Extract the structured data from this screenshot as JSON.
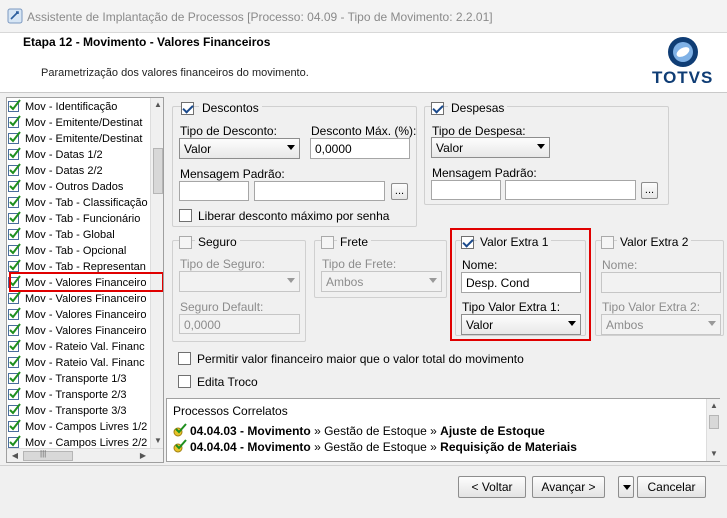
{
  "window": {
    "title": "Assistente de Implantação de Processos [Processo: 04.09 - Tipo de Movimento: 2.2.01]"
  },
  "header": {
    "step_title": "Etapa 12 - Movimento - Valores Financeiros",
    "step_description": "Parametrização dos valores financeiros do movimento.",
    "logo_text": "TOTVS"
  },
  "nav": {
    "items": [
      "Mov - Identificação",
      "Mov - Emitente/Destinat",
      "Mov - Emitente/Destinat",
      "Mov - Datas 1/2",
      "Mov - Datas 2/2",
      "Mov - Outros Dados",
      "Mov - Tab - Classificação",
      "Mov - Tab - Funcionário",
      "Mov - Tab - Global",
      "Mov - Tab - Opcional",
      "Mov - Tab - Representan",
      "Mov - Valores Financeiro",
      "Mov - Valores Financeiro",
      "Mov - Valores Financeiro",
      "Mov - Valores Financeiro",
      "Mov - Rateio Val. Financ",
      "Mov - Rateio Val. Financ",
      "Mov - Transporte 1/3",
      "Mov - Transporte 2/3",
      "Mov - Transporte 3/3",
      "Mov - Campos Livres 1/2",
      "Mov - Campos Livres 2/2"
    ],
    "selected_index": 11,
    "scroll_left": "◀",
    "scroll_right": "▶",
    "scroll_up": "▲",
    "scroll_down": "▼",
    "hthumb_grip": "|||"
  },
  "descontos": {
    "title": "Descontos",
    "checked": true,
    "tipo_label": "Tipo de Desconto:",
    "tipo_value": "Valor",
    "max_label": "Desconto Máx. (%):",
    "max_value": "0,0000",
    "msg_label": "Mensagem Padrão:",
    "msg_code": "",
    "msg_text": "",
    "lookup": "...",
    "liberar_label": "Liberar desconto máximo por senha"
  },
  "despesas": {
    "title": "Despesas",
    "checked": true,
    "tipo_label": "Tipo de Despesa:",
    "tipo_value": "Valor",
    "msg_label": "Mensagem Padrão:",
    "msg_code": "",
    "msg_text": "",
    "lookup": "..."
  },
  "seguro": {
    "title": "Seguro",
    "tipo_label": "Tipo de Seguro:",
    "tipo_value": "",
    "default_label": "Seguro Default:",
    "default_value": "0,0000"
  },
  "frete": {
    "title": "Frete",
    "tipo_label": "Tipo de Frete:",
    "tipo_value": "Ambos"
  },
  "valor_extra_1": {
    "title": "Valor Extra 1",
    "checked": true,
    "nome_label": "Nome:",
    "nome_value": "Desp. Cond",
    "tipo_label": "Tipo Valor Extra 1:",
    "tipo_value": "Valor"
  },
  "valor_extra_2": {
    "title": "Valor Extra 2",
    "nome_label": "Nome:",
    "nome_value": "",
    "tipo_label": "Tipo Valor Extra 2:",
    "tipo_value": "Ambos"
  },
  "options": {
    "permitir_label": "Permitir valor financeiro maior que o valor total do movimento",
    "edita_troco_label": "Edita Troco"
  },
  "processos": {
    "title": "Processos Correlatos",
    "rows": [
      {
        "code": "04.04.03",
        "sep1": " - ",
        "a": "Movimento",
        "b": "Gestão de Estoque",
        "c": "Ajuste de Estoque"
      },
      {
        "code": "04.04.04",
        "sep1": " - ",
        "a": "Movimento",
        "b": "Gestão de Estoque",
        "c": "Requisição de Materiais"
      }
    ],
    "arrow": " » "
  },
  "buttons": {
    "voltar": "< Voltar",
    "avancar": "Avançar >",
    "cancelar": "Cancelar"
  },
  "colors": {
    "highlight": "#e00000",
    "brand": "#0f3d75"
  }
}
